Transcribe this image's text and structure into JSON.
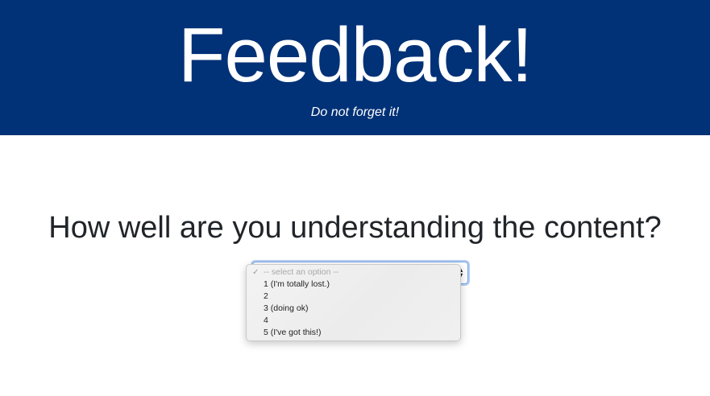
{
  "header": {
    "title": "Feedback!",
    "subtitle": "Do not forget it!",
    "background_color": "#013176"
  },
  "question": {
    "text": "How well are you understanding the content?"
  },
  "rating_select": {
    "selected_index": 0,
    "options": [
      "-- select an option --",
      "1 (I'm totally lost.)",
      "2",
      "3 (doing ok)",
      "4",
      "5 (I've got this!)"
    ]
  },
  "icons": {
    "checkmark": "checkmark-icon",
    "select_arrows": "up-down-arrows-icon"
  }
}
